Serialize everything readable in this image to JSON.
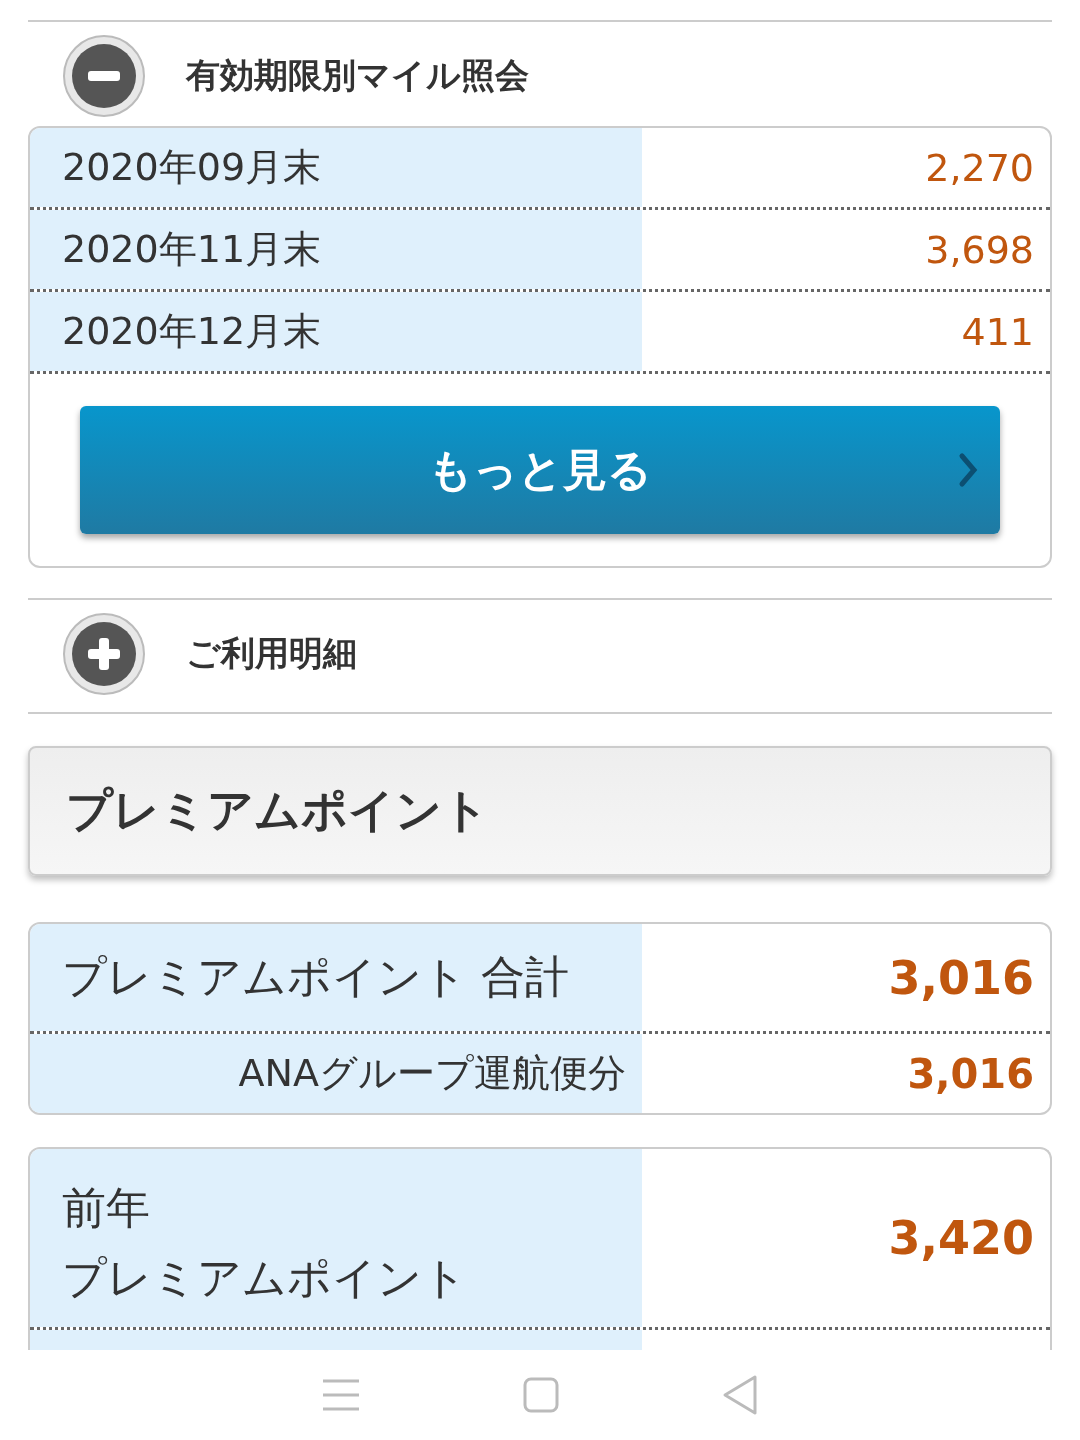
{
  "sections": [
    {
      "title": "有効期限別マイル照会",
      "expanded": true,
      "rows": [
        {
          "label": "2020年09月末",
          "value": "2,270"
        },
        {
          "label": "2020年11月末",
          "value": "3,698"
        },
        {
          "label": "2020年12月末",
          "value": "411"
        }
      ],
      "more_button": "もっと見る"
    },
    {
      "title": "ご利用明細",
      "expanded": false
    }
  ],
  "premium": {
    "heading": "プレミアムポイント",
    "total_rows": [
      {
        "kind": "total",
        "label": "プレミアムポイント 合計",
        "value": "3,016"
      },
      {
        "kind": "sub",
        "label": "ANAグループ運航便分",
        "value": "3,016"
      }
    ],
    "previous_rows": [
      {
        "kind": "two_line",
        "label_lines": [
          "前年",
          "プレミアムポイント"
        ],
        "value": "3,420"
      }
    ]
  }
}
